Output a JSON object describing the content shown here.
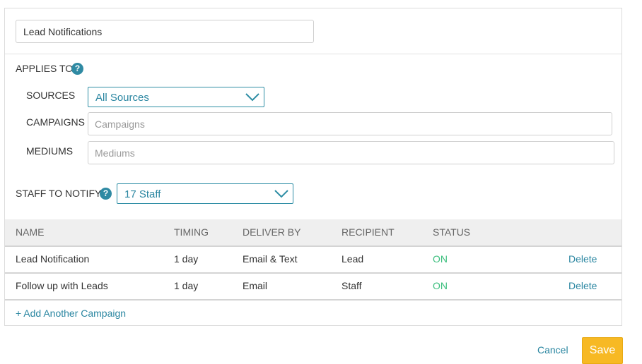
{
  "form": {
    "name_value": "Lead Notifications"
  },
  "applies_to": {
    "label": "APPLIES TO",
    "help_glyph": "?",
    "sources_label": "SOURCES",
    "sources_value": "All Sources",
    "campaigns_label": "CAMPAIGNS",
    "campaigns_placeholder": "Campaigns",
    "mediums_label": "MEDIUMS",
    "mediums_placeholder": "Mediums"
  },
  "staff": {
    "label": "STAFF TO NOTIFY",
    "help_glyph": "?",
    "value": "17 Staff"
  },
  "table": {
    "headers": {
      "name": "NAME",
      "timing": "TIMING",
      "deliver_by": "DELIVER BY",
      "recipient": "RECIPIENT",
      "status": "STATUS"
    },
    "rows": [
      {
        "name": "Lead Notification",
        "timing": "1 day",
        "deliver_by": "Email & Text",
        "recipient": "Lead",
        "status": "ON",
        "action": "Delete"
      },
      {
        "name": "Follow up with Leads",
        "timing": "1 day",
        "deliver_by": "Email",
        "recipient": "Staff",
        "status": "ON",
        "action": "Delete"
      }
    ]
  },
  "add_campaign_label": "+ Add Another Campaign",
  "footer": {
    "cancel_label": "Cancel",
    "save_label": "Save"
  },
  "colors": {
    "accent": "#2a86a1",
    "status_on": "#3cbf7e",
    "save_button": "#f7b924"
  },
  "icons": {
    "help": "question-circle-icon",
    "dropdown": "chevron-down-icon"
  }
}
